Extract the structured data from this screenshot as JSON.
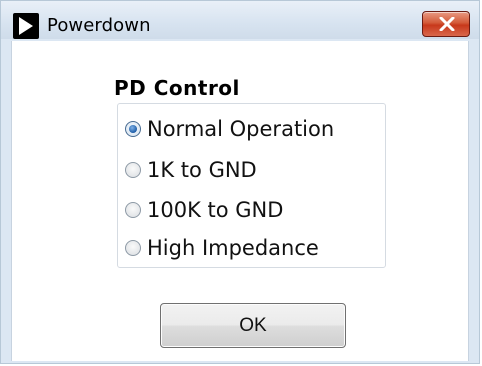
{
  "window": {
    "title": "Powerdown",
    "title_icon": "play-arrow-icon",
    "close_icon": "close-x-icon"
  },
  "pd_control": {
    "label": "PD Control",
    "options": [
      {
        "label": "Normal Operation",
        "checked": true
      },
      {
        "label": "1K to GND",
        "checked": false
      },
      {
        "label": "100K to GND",
        "checked": false
      },
      {
        "label": "High Impedance",
        "checked": false
      }
    ],
    "selected": "Normal Operation"
  },
  "actions": {
    "ok_label": "OK"
  },
  "colors": {
    "close_button": "#c8381b",
    "radio_selected": "#1d5da8",
    "titlebar": "#d7e3f0"
  }
}
